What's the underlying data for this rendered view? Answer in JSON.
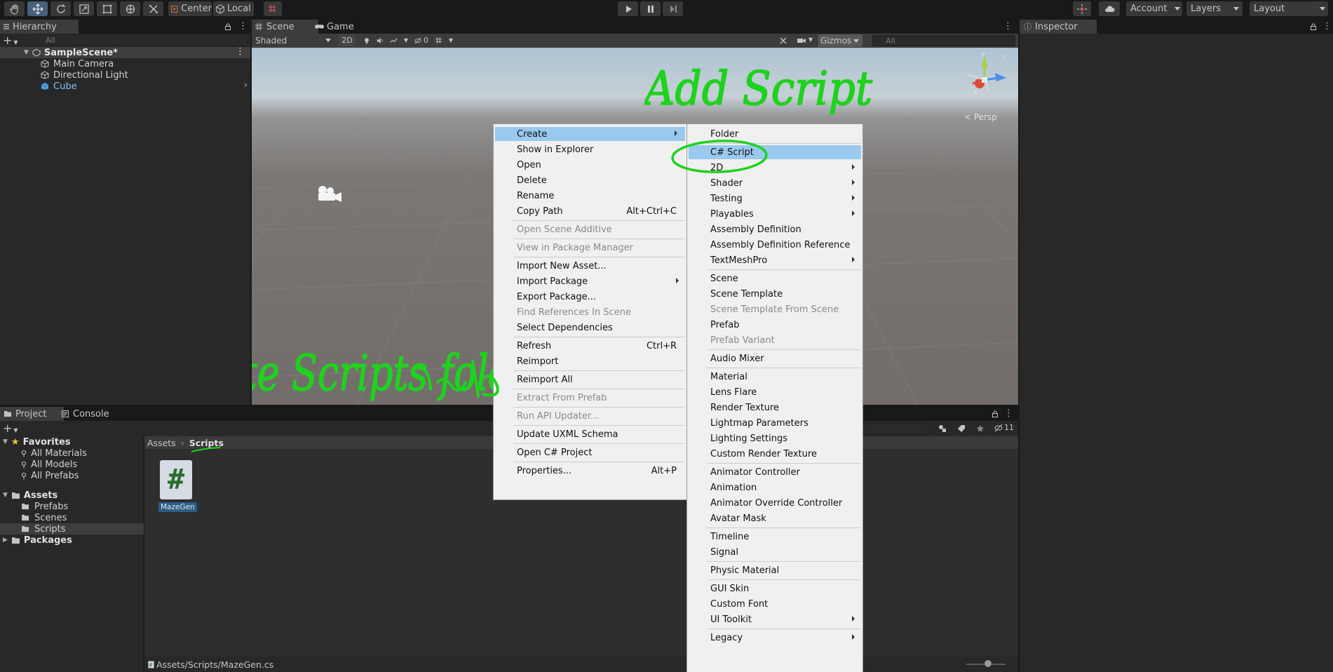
{
  "toolbar": {
    "pivot_label": "Center",
    "space_label": "Local",
    "account_label": "Account",
    "layers_label": "Layers",
    "layout_label": "Layout"
  },
  "hierarchy": {
    "tab": "Hierarchy",
    "search_placeholder": "All",
    "scene": "SampleScene*",
    "items": [
      "Main Camera",
      "Directional Light",
      "Cube"
    ]
  },
  "scene_view": {
    "tabs": [
      "Scene",
      "Game"
    ],
    "shading": "Shaded",
    "mode_2d": "2D",
    "hidden_count": "0",
    "gizmos": "Gizmos",
    "search_placeholder": "All",
    "persp_label": "Persp"
  },
  "inspector": {
    "tab": "Inspector"
  },
  "project": {
    "tabs": [
      "Project",
      "Console"
    ],
    "favorites": {
      "label": "Favorites",
      "items": [
        "All Materials",
        "All Models",
        "All Prefabs"
      ]
    },
    "assets": {
      "label": "Assets",
      "items": [
        "Prefabs",
        "Scenes",
        "Scripts"
      ]
    },
    "packages_label": "Packages",
    "breadcrumb": [
      "Assets",
      "Scripts"
    ],
    "files": [
      {
        "name": "MazeGen",
        "glyph": "#"
      }
    ],
    "status_path": "Assets/Scripts/MazeGen.cs",
    "hidden_count": "11"
  },
  "context_menu": {
    "items": [
      {
        "label": "Create",
        "submenu": true,
        "highlighted": true
      },
      {
        "label": "Show in Explorer"
      },
      {
        "label": "Open"
      },
      {
        "label": "Delete"
      },
      {
        "label": "Rename"
      },
      {
        "label": "Copy Path",
        "shortcut": "Alt+Ctrl+C"
      },
      {
        "label": "Open Scene Additive",
        "disabled": true
      },
      {
        "label": "View in Package Manager",
        "disabled": true
      },
      {
        "label": "Import New Asset..."
      },
      {
        "label": "Import Package",
        "submenu": true
      },
      {
        "label": "Export Package..."
      },
      {
        "label": "Find References In Scene",
        "disabled": true
      },
      {
        "label": "Select Dependencies"
      },
      {
        "label": "Refresh",
        "shortcut": "Ctrl+R"
      },
      {
        "label": "Reimport"
      },
      {
        "label": "Reimport All"
      },
      {
        "label": "Extract From Prefab",
        "disabled": true
      },
      {
        "label": "Run API Updater...",
        "disabled": true
      },
      {
        "label": "Update UXML Schema"
      },
      {
        "label": "Open C# Project"
      },
      {
        "label": "Properties...",
        "shortcut": "Alt+P"
      }
    ]
  },
  "create_submenu": {
    "items": [
      {
        "label": "Folder"
      },
      {
        "label": "C# Script",
        "highlighted": true
      },
      {
        "label": "2D",
        "submenu": true
      },
      {
        "label": "Shader",
        "submenu": true
      },
      {
        "label": "Testing",
        "submenu": true
      },
      {
        "label": "Playables",
        "submenu": true
      },
      {
        "label": "Assembly Definition"
      },
      {
        "label": "Assembly Definition Reference"
      },
      {
        "label": "TextMeshPro",
        "submenu": true
      },
      {
        "label": "Scene"
      },
      {
        "label": "Scene Template"
      },
      {
        "label": "Scene Template From Scene",
        "disabled": true
      },
      {
        "label": "Prefab"
      },
      {
        "label": "Prefab Variant",
        "disabled": true
      },
      {
        "label": "Audio Mixer"
      },
      {
        "label": "Material"
      },
      {
        "label": "Lens Flare"
      },
      {
        "label": "Render Texture"
      },
      {
        "label": "Lightmap Parameters"
      },
      {
        "label": "Lighting Settings"
      },
      {
        "label": "Custom Render Texture"
      },
      {
        "label": "Animator Controller"
      },
      {
        "label": "Animation"
      },
      {
        "label": "Animator Override Controller"
      },
      {
        "label": "Avatar Mask"
      },
      {
        "label": "Timeline"
      },
      {
        "label": "Signal"
      },
      {
        "label": "Physic Material"
      },
      {
        "label": "GUI Skin"
      },
      {
        "label": "Custom Font"
      },
      {
        "label": "UI Toolkit",
        "submenu": true
      },
      {
        "label": "Legacy",
        "submenu": true
      }
    ]
  },
  "annotations": {
    "add_script": "Add Script",
    "create_folder": "Create Scripts folder",
    "color": "#1ed21e"
  },
  "colors": {
    "accent_selection": "#46607c",
    "menu_highlight": "#99c9ef",
    "cube_blue": "#7cc4f8"
  }
}
